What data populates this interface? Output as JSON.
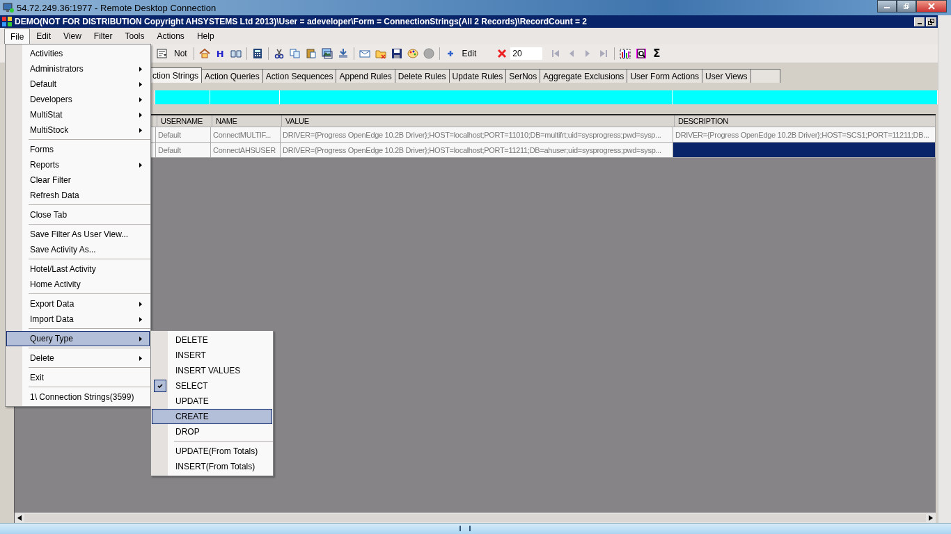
{
  "remote_window": {
    "title": "54.72.249.36:1977 - Remote Desktop Connection"
  },
  "app_window": {
    "title": "DEMO(NOT FOR DISTRIBUTION Copyright AHSYSTEMS Ltd 2013)\\User = adeveloper\\Form = ConnectionStrings(All 2 Records)\\RecordCount = 2"
  },
  "menu_bar": [
    {
      "label": "File",
      "selected": true
    },
    {
      "label": "Edit",
      "selected": false
    },
    {
      "label": "View",
      "selected": false
    },
    {
      "label": "Filter",
      "selected": false
    },
    {
      "label": "Tools",
      "selected": false
    },
    {
      "label": "Actions",
      "selected": false
    },
    {
      "label": "Help",
      "selected": false
    }
  ],
  "toolbar": [
    {
      "kind": "filter-form"
    },
    {
      "kind": "label",
      "text": "Not"
    },
    {
      "kind": "sep"
    },
    {
      "kind": "home"
    },
    {
      "kind": "glyph",
      "text": "H"
    },
    {
      "kind": "book"
    },
    {
      "kind": "sep"
    },
    {
      "kind": "calculator"
    },
    {
      "kind": "sep"
    },
    {
      "kind": "cut"
    },
    {
      "kind": "copy"
    },
    {
      "kind": "paste"
    },
    {
      "kind": "image"
    },
    {
      "kind": "download"
    },
    {
      "kind": "sep"
    },
    {
      "kind": "envelope"
    },
    {
      "kind": "folder"
    },
    {
      "kind": "save"
    },
    {
      "kind": "palette"
    },
    {
      "kind": "circle"
    },
    {
      "kind": "sep"
    },
    {
      "kind": "plus"
    },
    {
      "kind": "label",
      "text": "Edit"
    },
    {
      "kind": "delete"
    },
    {
      "kind": "field",
      "value": "20"
    },
    {
      "kind": "first"
    },
    {
      "kind": "prev"
    },
    {
      "kind": "next"
    },
    {
      "kind": "last"
    },
    {
      "kind": "sep"
    },
    {
      "kind": "chart"
    },
    {
      "kind": "preview"
    },
    {
      "kind": "glyph",
      "text": "Σ"
    }
  ],
  "tabs": [
    {
      "label": "ction Strings",
      "selected": true
    },
    {
      "label": "Action Queries",
      "selected": false
    },
    {
      "label": "Action Sequences",
      "selected": false
    },
    {
      "label": "Append Rules",
      "selected": false
    },
    {
      "label": "Delete Rules",
      "selected": false
    },
    {
      "label": "Update Rules",
      "selected": false
    },
    {
      "label": "SerNos",
      "selected": false
    },
    {
      "label": "Aggregate Exclusions",
      "selected": false
    },
    {
      "label": "User Form Actions",
      "selected": false
    },
    {
      "label": "User Views",
      "selected": false
    },
    {
      "selected": false
    }
  ],
  "table": {
    "columns": [
      "USERNAME",
      "NAME",
      "VALUE",
      "DESCRIPTION"
    ],
    "rows": [
      {
        "username": "Default",
        "name": "ConnectMULTIF...",
        "value": "DRIVER={Progress OpenEdge 10.2B Driver};HOST=localhost;PORT=11010;DB=multifrt;uid=sysprogress;pwd=sysp...",
        "description": {
          "text": "DRIVER={Progress OpenEdge 10.2B Driver};HOST=SCS1;PORT=11211;DB...",
          "selected": false
        }
      },
      {
        "username": "Default",
        "name": "ConnectAHSUSER",
        "value": "DRIVER={Progress OpenEdge 10.2B Driver};HOST=localhost;PORT=11211;DB=ahuser;uid=sysprogress;pwd=sysp...",
        "description": {
          "selected": true
        }
      }
    ]
  },
  "file_menu": [
    {
      "kind": "item",
      "label": "Activities",
      "selected": false
    },
    {
      "kind": "submenu",
      "label": "Administrators",
      "selected": false
    },
    {
      "kind": "submenu",
      "label": "Default",
      "selected": false
    },
    {
      "kind": "submenu",
      "label": "Developers",
      "selected": false
    },
    {
      "kind": "submenu",
      "label": "MultiStat",
      "selected": false
    },
    {
      "kind": "submenu",
      "label": "MultiStock",
      "selected": false
    },
    {
      "kind": "separator"
    },
    {
      "kind": "item",
      "label": "Forms",
      "selected": false
    },
    {
      "kind": "submenu",
      "label": "Reports",
      "selected": false
    },
    {
      "kind": "item",
      "label": "Clear Filter",
      "selected": false
    },
    {
      "kind": "item",
      "label": "Refresh Data",
      "selected": false
    },
    {
      "kind": "separator"
    },
    {
      "kind": "item",
      "label": "Close Tab",
      "selected": false
    },
    {
      "kind": "separator"
    },
    {
      "kind": "item",
      "label": "Save Filter As User View...",
      "selected": false
    },
    {
      "kind": "item",
      "label": "Save Activity As...",
      "selected": false
    },
    {
      "kind": "separator"
    },
    {
      "kind": "item",
      "label": "Hotel/Last Activity",
      "selected": false
    },
    {
      "kind": "item",
      "label": "Home Activity",
      "selected": false
    },
    {
      "kind": "separator"
    },
    {
      "kind": "submenu",
      "label": "Export Data",
      "selected": false
    },
    {
      "kind": "submenu",
      "label": "Import Data",
      "selected": false
    },
    {
      "kind": "separator"
    },
    {
      "kind": "submenu",
      "label": "Query Type",
      "selected": true
    },
    {
      "kind": "separator"
    },
    {
      "kind": "submenu",
      "label": "Delete",
      "selected": false
    },
    {
      "kind": "separator"
    },
    {
      "kind": "item",
      "label": "Exit",
      "selected": false
    },
    {
      "kind": "separator"
    },
    {
      "kind": "item",
      "label": "1\\ Connection Strings(3599)",
      "selected": false
    }
  ],
  "query_type_menu": [
    {
      "kind": "item",
      "label": "DELETE",
      "checked": false,
      "selected": false
    },
    {
      "kind": "item",
      "label": "INSERT",
      "checked": false,
      "selected": false
    },
    {
      "kind": "item",
      "label": "INSERT VALUES",
      "checked": false,
      "selected": false
    },
    {
      "kind": "item",
      "label": "SELECT",
      "checked": true,
      "selected": false
    },
    {
      "kind": "item",
      "label": "UPDATE",
      "checked": false,
      "selected": false
    },
    {
      "kind": "item",
      "label": "CREATE",
      "checked": false,
      "selected": true
    },
    {
      "kind": "item",
      "label": "DROP",
      "checked": false,
      "selected": false
    },
    {
      "kind": "separator"
    },
    {
      "kind": "item",
      "label": "UPDATE(From Totals)",
      "checked": false,
      "selected": false
    },
    {
      "kind": "item",
      "label": "INSERT(From Totals)",
      "checked": false,
      "selected": false
    }
  ]
}
